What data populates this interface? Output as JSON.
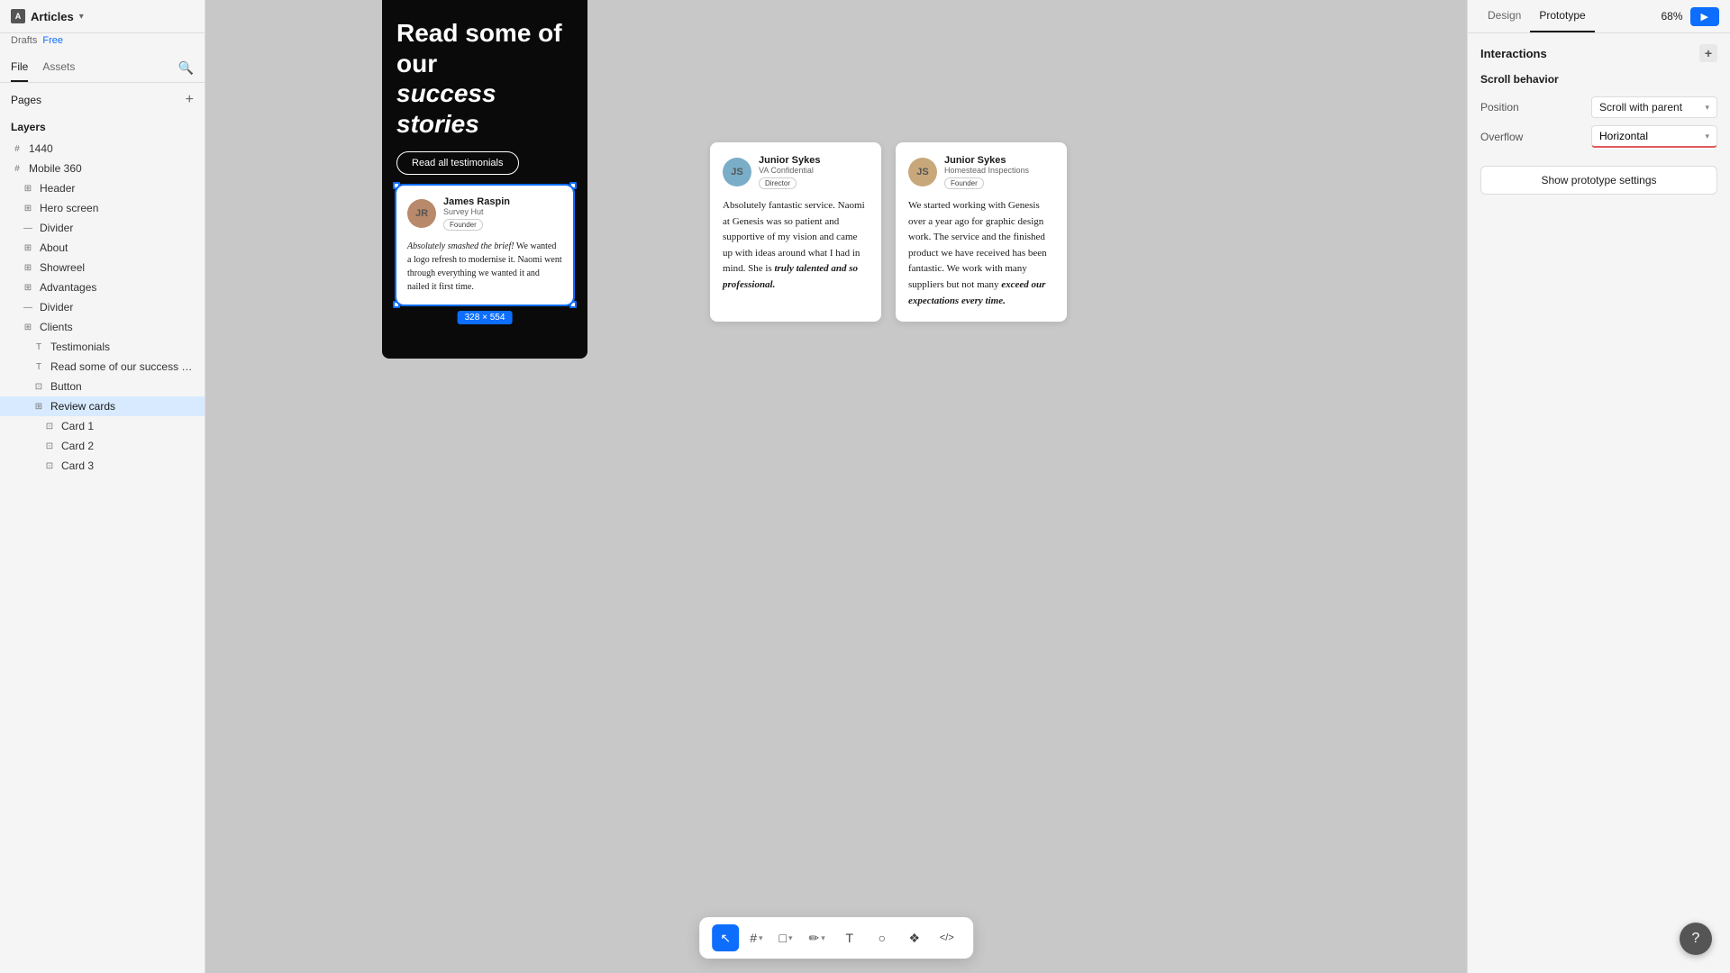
{
  "app": {
    "project_name": "Articles",
    "plan_drafts": "Drafts",
    "plan_type": "Free"
  },
  "left_sidebar": {
    "file_tab": "File",
    "assets_tab": "Assets",
    "pages_label": "Pages",
    "layers_label": "Layers",
    "layers": [
      {
        "id": "frame-1440",
        "label": "1440",
        "icon": "#",
        "indent": 0,
        "type": "frame"
      },
      {
        "id": "mobile-360",
        "label": "Mobile 360",
        "icon": "#",
        "indent": 0,
        "type": "frame"
      },
      {
        "id": "header",
        "label": "Header",
        "icon": "⊞",
        "indent": 1,
        "type": "component"
      },
      {
        "id": "hero-screen",
        "label": "Hero screen",
        "icon": "⊞",
        "indent": 1,
        "type": "component"
      },
      {
        "id": "divider-1",
        "label": "Divider",
        "icon": "—",
        "indent": 1,
        "type": "line"
      },
      {
        "id": "about",
        "label": "About",
        "icon": "⊞",
        "indent": 1,
        "type": "component"
      },
      {
        "id": "showreel",
        "label": "Showreel",
        "icon": "⊞",
        "indent": 1,
        "type": "component"
      },
      {
        "id": "advantages",
        "label": "Advantages",
        "icon": "⊞",
        "indent": 1,
        "type": "component"
      },
      {
        "id": "divider-2",
        "label": "Divider",
        "icon": "—",
        "indent": 1,
        "type": "line"
      },
      {
        "id": "clients",
        "label": "Clients",
        "icon": "⊞",
        "indent": 1,
        "type": "component"
      },
      {
        "id": "testimonials",
        "label": "Testimonials",
        "icon": "T",
        "indent": 2,
        "type": "text"
      },
      {
        "id": "read-some",
        "label": "Read some of our success st…",
        "icon": "T",
        "indent": 2,
        "type": "text"
      },
      {
        "id": "button",
        "label": "Button",
        "icon": "⊡",
        "indent": 2,
        "type": "component"
      },
      {
        "id": "review-cards",
        "label": "Review cards",
        "icon": "⊞",
        "indent": 2,
        "type": "component",
        "active": true
      },
      {
        "id": "card-1",
        "label": "Card 1",
        "icon": "⊡",
        "indent": 3,
        "type": "component"
      },
      {
        "id": "card-2",
        "label": "Card 2",
        "icon": "⊡",
        "indent": 3,
        "type": "component"
      },
      {
        "id": "card-3",
        "label": "Card 3",
        "icon": "⊡",
        "indent": 3,
        "type": "component"
      }
    ]
  },
  "canvas": {
    "phone": {
      "title_line1": "Read some of our",
      "title_line2": "success stories",
      "button_label": "Read all testimonials",
      "card_selected": {
        "person_name": "James Raspin",
        "company": "Survey Hut",
        "badge": "Founder",
        "quote_italic": "Absolutely smashed the brief!",
        "quote_rest": " We wanted a logo refresh to modernise it. Naomi went through everything we wanted it and nailed it first time.",
        "size": "328 × 554"
      }
    },
    "cards": [
      {
        "person_name": "Junior Sykes",
        "company": "VA Confidential",
        "badge": "Director",
        "quote": "Absolutely fantastic service. Naomi at Genesis was so patient and supportive of my vision and came up with ideas around what I had in mind. She is truly talented and so professional.",
        "quote_italic_part": "truly talented and so professional."
      },
      {
        "person_name": "Junior Sykes",
        "company": "Homestead Inspections",
        "badge": "Founder",
        "quote": "We started working with Genesis over a year ago for graphic design work. The service and the finished product we have received has been fantastic. We work with many suppliers but not many exceed our expectations every time.",
        "quote_italic_part": "exceed our expectations every time."
      }
    ]
  },
  "toolbar": {
    "tools": [
      {
        "id": "select",
        "icon": "↖",
        "active": true
      },
      {
        "id": "frame",
        "icon": "#",
        "active": false
      },
      {
        "id": "shape",
        "icon": "□",
        "active": false
      },
      {
        "id": "pen",
        "icon": "✏",
        "active": false
      },
      {
        "id": "text",
        "icon": "T",
        "active": false
      },
      {
        "id": "comment",
        "icon": "💬",
        "active": false
      },
      {
        "id": "components",
        "icon": "❖",
        "active": false
      },
      {
        "id": "code",
        "icon": "</>",
        "active": false
      }
    ]
  },
  "right_panel": {
    "tabs": {
      "design": "Design",
      "prototype": "Prototype",
      "active": "prototype"
    },
    "zoom": "68%",
    "button_label": "…",
    "interactions_label": "Interactions",
    "scroll_behavior_label": "Scroll behavior",
    "position_label": "Position",
    "position_value": "Scroll with parent",
    "overflow_label": "Overflow",
    "overflow_value": "Horizontal",
    "show_proto_btn": "Show prototype settings"
  },
  "help": {
    "icon": "?"
  }
}
